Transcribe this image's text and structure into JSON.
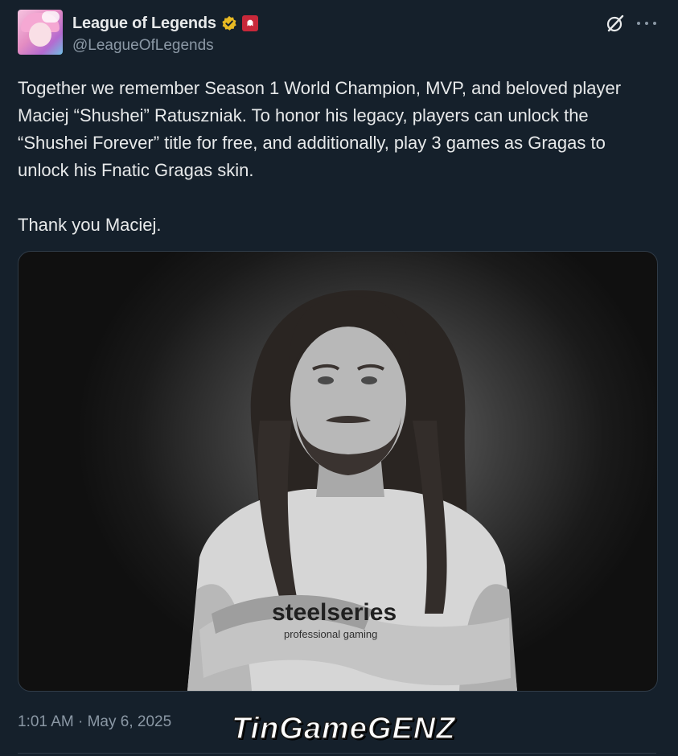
{
  "account": {
    "display_name": "League of Legends",
    "handle": "@LeagueOfLegends",
    "verified_badge_color": "#e8b923",
    "affiliate_badge_color": "#c8283a"
  },
  "actions": {
    "grok_icon": "grok-icon",
    "more_icon": "more-icon"
  },
  "tweet": {
    "text": "Together we remember Season 1 World Champion, MVP, and beloved player Maciej “Shushei” Ratuszniak. To honor his legacy, players can unlock the “Shushei Forever” title for free, and additionally, play 3 games as Gragas to unlock his Fnatic Gragas skin.\n\nThank you Maciej.",
    "timestamp": "1:01 AM · May 6, 2025"
  },
  "media": {
    "shirt_text": "steelseries",
    "shirt_subtext": "professional gaming"
  },
  "watermark": {
    "text": "TinGameGENZ"
  },
  "colors": {
    "background": "#15202b",
    "text": "#e7e9ea",
    "muted": "#8b98a5"
  }
}
